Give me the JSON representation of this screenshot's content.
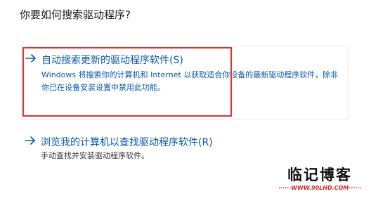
{
  "dialog": {
    "question": "你要如何搜索驱动程序?"
  },
  "options": [
    {
      "title": "自动搜索更新的驱动程序软件(S)",
      "description": "Windows 将搜索你的计算机和 Internet 以获取适合你设备的最新驱动程序软件，除非你已在设备安装设置中禁用此功能。",
      "icon": "arrow-right-icon"
    },
    {
      "title": "浏览我的计算机以查找驱动程序软件(R)",
      "description": "手动查找并安装驱动程序软件。",
      "icon": "arrow-right-icon"
    }
  ],
  "annotation": {
    "highlight_color": "#e0332b"
  },
  "colors": {
    "link": "#0b5aa8",
    "text": "#1a1a1a"
  },
  "watermark": {
    "name": "临记博客",
    "url": "······WWW.90LHD.COM······"
  }
}
